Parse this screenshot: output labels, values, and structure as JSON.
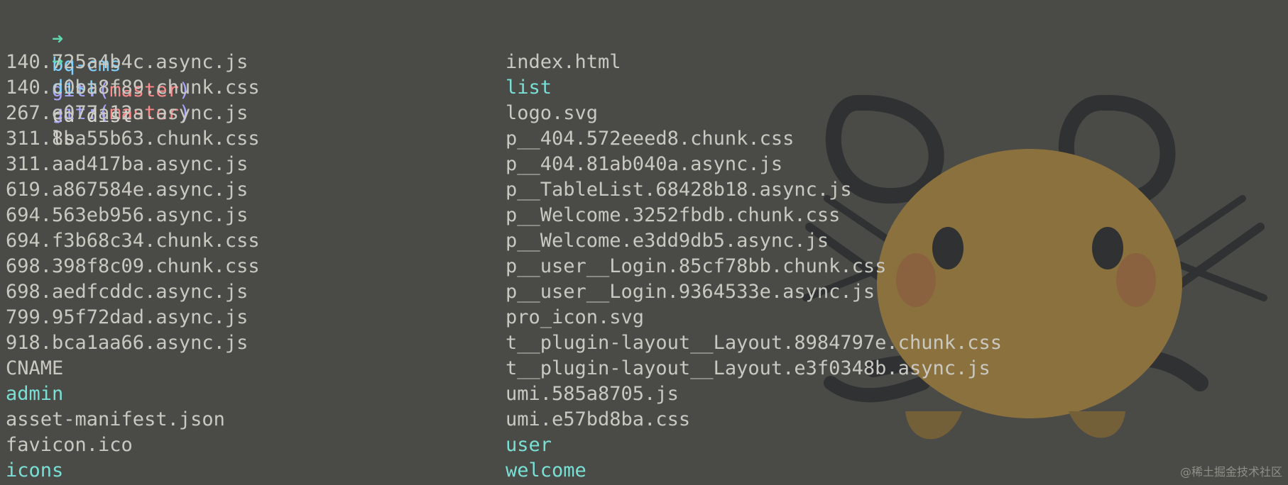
{
  "terminal": {
    "lines": [
      {
        "arrow": "➜",
        "dir": "bq-cms",
        "git": "git:(",
        "branch": "master",
        "git_close": ")",
        "command": "cd dist"
      },
      {
        "arrow": "➜",
        "dir": "dist",
        "git": "git:(",
        "branch": "master",
        "git_close": ")",
        "command": "ls"
      }
    ],
    "left_entries": [
      {
        "name": "140.725a4b4c.async.js"
      },
      {
        "name": "140.c0ba8f89.chunk.css"
      },
      {
        "name": "267.e077a12a.async.js"
      },
      {
        "name": "311.8ba55b63.chunk.css"
      },
      {
        "name": "311.aad417ba.async.js"
      },
      {
        "name": "619.a867584e.async.js"
      },
      {
        "name": "694.563eb956.async.js"
      },
      {
        "name": "694.f3b68c34.chunk.css"
      },
      {
        "name": "698.398f8c09.chunk.css"
      },
      {
        "name": "698.aedfcddc.async.js"
      },
      {
        "name": "799.95f72dad.async.js"
      },
      {
        "name": "918.bca1aa66.async.js"
      },
      {
        "name": "CNAME"
      },
      {
        "name": "admin"
      },
      {
        "name": "asset-manifest.json"
      },
      {
        "name": "favicon.ico"
      },
      {
        "name": "icons"
      }
    ],
    "right_entries": [
      {
        "name": "index.html"
      },
      {
        "name": "list"
      },
      {
        "name": "logo.svg"
      },
      {
        "name": "p__404.572eeed8.chunk.css"
      },
      {
        "name": "p__404.81ab040a.async.js"
      },
      {
        "name": "p__TableList.68428b18.async.js"
      },
      {
        "name": "p__Welcome.3252fbdb.chunk.css"
      },
      {
        "name": "p__Welcome.e3dd9db5.async.js"
      },
      {
        "name": "p__user__Login.85cf78bb.chunk.css"
      },
      {
        "name": "p__user__Login.9364533e.async.js"
      },
      {
        "name": "pro_icon.svg"
      },
      {
        "name": "t__plugin-layout__Layout.8984797e.chunk.css"
      },
      {
        "name": "t__plugin-layout__Layout.e3f0348b.async.js"
      },
      {
        "name": "umi.585a8705.js"
      },
      {
        "name": "umi.e57bd8ba.css"
      },
      {
        "name": "user"
      },
      {
        "name": "welcome"
      }
    ],
    "watermark": "@稀土掘金技术社区"
  },
  "colors": {
    "background": "#4a4a46",
    "arrow": "#5fd7af",
    "directory": "#79e0d6",
    "git": "#a8a6ff",
    "branch": "#ff8c8c"
  },
  "icons": {
    "mascot": "dedenne-mascot-icon"
  }
}
